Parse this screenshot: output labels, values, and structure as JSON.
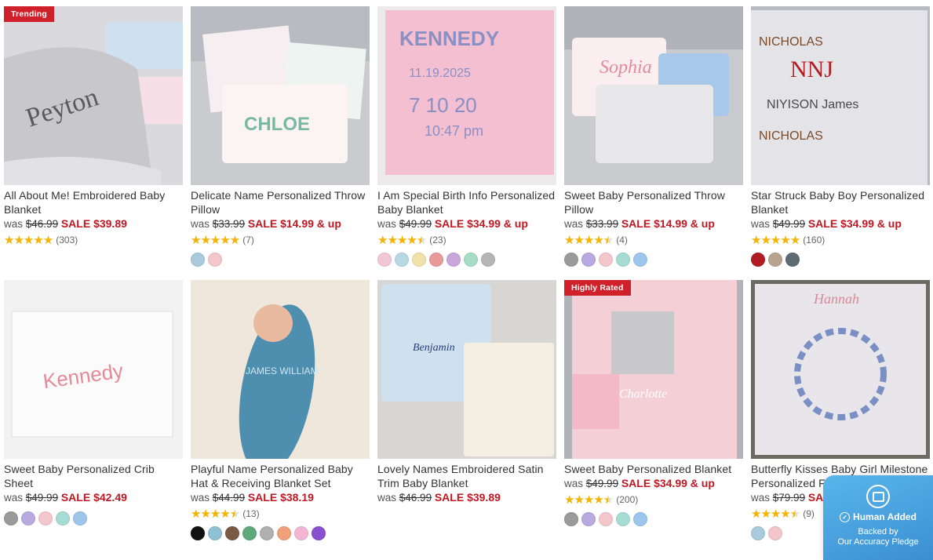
{
  "products": [
    {
      "name": "All About Me! Embroidered Baby Blanket",
      "was_label": "was",
      "was_price": "$46.99",
      "sale": "SALE $39.89",
      "rating": 5,
      "reviews": "(303)",
      "badge": "Trending",
      "swatches": [],
      "thumb_text": "Peyton",
      "thumb_bg": "#d9d9de"
    },
    {
      "name": "Delicate Name Personalized Throw Pillow",
      "was_label": "was",
      "was_price": "$33.99",
      "sale": "SALE $14.99 & up",
      "rating": 5,
      "reviews": "(7)",
      "badge": "",
      "swatches": [
        "#a9c9dc",
        "#f3c6cc"
      ],
      "thumb_text": "CHLOE",
      "thumb_bg": "#c9cbcf"
    },
    {
      "name": "I Am Special Birth Info Personalized Baby Blanket",
      "was_label": "was",
      "was_price": "$49.99",
      "sale": "SALE $34.99 & up",
      "rating": 4.5,
      "reviews": "(23)",
      "badge": "",
      "swatches": [
        "#f2c6d4",
        "#b9d8e4",
        "#f0e2a8",
        "#e89a9a",
        "#c9a6dc",
        "#a6dcc8",
        "#b5b5b5"
      ],
      "thumb_text": "KENNEDY",
      "thumb_bg": "#f4bfd0"
    },
    {
      "name": "Sweet Baby Personalized Throw Pillow",
      "was_label": "was",
      "was_price": "$33.99",
      "sale": "SALE $14.99 & up",
      "rating": 4.5,
      "reviews": "(4)",
      "badge": "",
      "swatches": [
        "#9a9a9a",
        "#b8a9e0",
        "#f3c6cc",
        "#a6dcd4",
        "#9cc6ec"
      ],
      "thumb_text": "Sophia",
      "thumb_bg": "#c9cbcf"
    },
    {
      "name": "Star Struck Baby Boy Personalized Blanket",
      "was_label": "was",
      "was_price": "$49.99",
      "sale": "SALE $34.99 & up",
      "rating": 5,
      "reviews": "(160)",
      "badge": "",
      "swatches": [
        "#b01c22",
        "#b7a48c",
        "#5e6b73"
      ],
      "thumb_text": "NICHOLAS",
      "thumb_bg": "#e4e4e8"
    },
    {
      "name": "Sweet Baby Personalized Crib Sheet",
      "was_label": "was",
      "was_price": "$49.99",
      "sale": "SALE $42.49",
      "rating": 0,
      "reviews": "",
      "badge": "",
      "swatches": [
        "#9a9a9a",
        "#b8a9e0",
        "#f3c6cc",
        "#a6dcd4",
        "#9cc6ec"
      ],
      "thumb_text": "Kennedy",
      "thumb_bg": "#f2f2f2"
    },
    {
      "name": "Playful Name Personalized Baby Hat & Receiving Blanket Set",
      "was_label": "was",
      "was_price": "$44.99",
      "sale": "SALE $38.19",
      "rating": 4.5,
      "reviews": "(13)",
      "badge": "",
      "swatches": [
        "#111111",
        "#8fc0d6",
        "#7a5a44",
        "#5ea87a",
        "#b0b0b0",
        "#f2a07a",
        "#f2b6d2",
        "#8a4fd0"
      ],
      "thumb_text": "JAMES WILLIAM",
      "thumb_bg": "#efe6dc"
    },
    {
      "name": "Lovely Names Embroidered Satin Trim Baby Blanket",
      "was_label": "was",
      "was_price": "$46.99",
      "sale": "SALE $39.89",
      "rating": 0,
      "reviews": "",
      "badge": "",
      "swatches": [],
      "thumb_text": "Benjamin",
      "thumb_bg": "#d8d6d2"
    },
    {
      "name": "Sweet Baby Personalized Blanket",
      "was_label": "was",
      "was_price": "$49.99",
      "sale": "SALE $34.99 & up",
      "rating": 4.5,
      "reviews": "(200)",
      "badge": "Highly Rated",
      "swatches": [
        "#9a9a9a",
        "#b8a9e0",
        "#f3c6cc",
        "#a6dcd4",
        "#9cc6ec"
      ],
      "thumb_text": "Charlotte",
      "thumb_bg": "#f4d0d6"
    },
    {
      "name": "Butterfly Kisses Baby Girl Milestone Personalized Fleece Blanket",
      "was_label": "was",
      "was_price": "$79.99",
      "sale": "SALE $34.99",
      "rating": 4.5,
      "reviews": "(9)",
      "badge": "",
      "swatches": [
        "#a9c9dc",
        "#f3c6cc"
      ],
      "thumb_text": "Hannah",
      "thumb_bg": "#e8e6ea"
    }
  ],
  "widget": {
    "title": "Human Added",
    "line2": "Backed by",
    "line3": "Our Accuracy Pledge"
  },
  "colors": {
    "sale": "#c01722",
    "badge": "#d0202a",
    "star": "#f4b400"
  }
}
